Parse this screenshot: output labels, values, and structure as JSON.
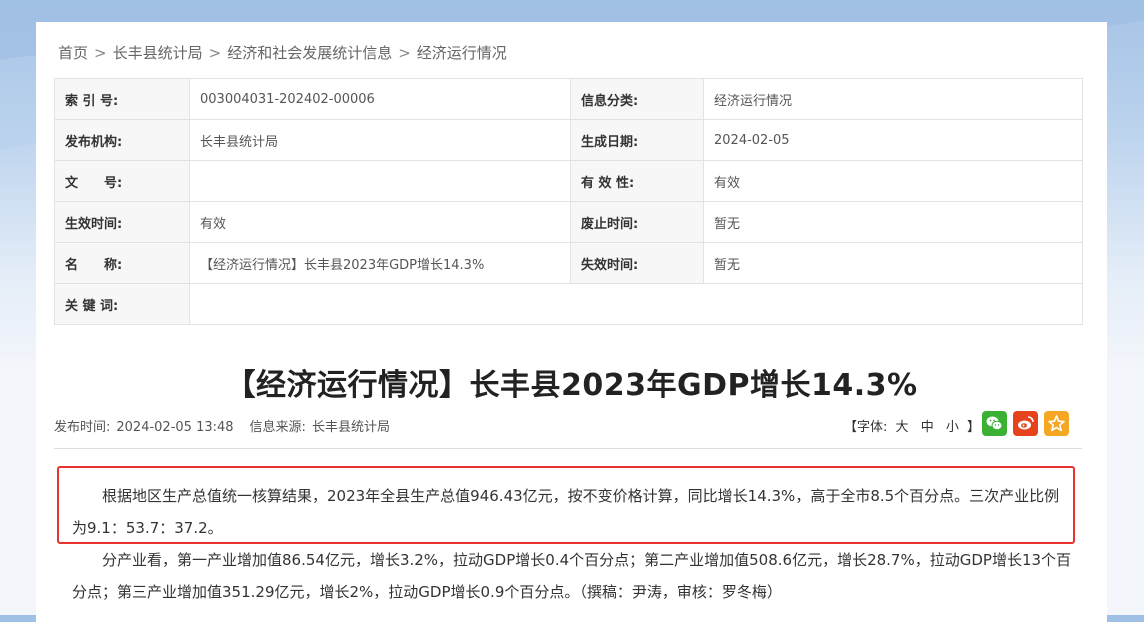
{
  "breadcrumb": [
    "首页",
    "长丰县统计局",
    "经济和社会发展统计信息",
    "经济运行情况"
  ],
  "breadcrumb_sep": ">",
  "meta": {
    "index_label": "索 引 号:",
    "index_value": "003004031-202402-00006",
    "category_label": "信息分类:",
    "category_value": "经济运行情况",
    "org_label": "发布机构:",
    "org_value": "长丰县统计局",
    "gen_date_label": "生成日期:",
    "gen_date_value": "2024-02-05",
    "doc_no_label": "文　　号:",
    "doc_no_value": "",
    "validity_label": "有 效 性:",
    "validity_value": "有效",
    "effective_label": "生效时间:",
    "effective_value": "有效",
    "repeal_label": "废止时间:",
    "repeal_value": "暂无",
    "name_label": "名　　称:",
    "name_value": "【经济运行情况】长丰县2023年GDP增长14.3%",
    "expire_label": "失效时间:",
    "expire_value": "暂无",
    "keywords_label": "关 键 词:",
    "keywords_value": ""
  },
  "article": {
    "title": "【经济运行情况】长丰县2023年GDP增长14.3%",
    "publish_label": "发布时间:",
    "publish_time": "2024-02-05 13:48",
    "source_label": "信息来源:",
    "source": "长丰县统计局",
    "font_open": "【字体:",
    "font_large": "大",
    "font_medium": "中",
    "font_small": "小",
    "font_close": "】",
    "para1": "根据地区生产总值统一核算结果，2023年全县生产总值946.43亿元，按不变价格计算，同比增长14.3%，高于全市8.5个百分点。三次产业比例为9.1：53.7：37.2。",
    "para2": "分产业看，第一产业增加值86.54亿元，增长3.2%，拉动GDP增长0.4个百分点；第二产业增加值508.6亿元，增长28.7%，拉动GDP增长13个百分点；第三产业增加值351.29亿元，增长2%，拉动GDP增长0.9个百分点。（撰稿：尹涛，审核：罗冬梅）"
  },
  "share_icons": [
    "wechat-icon",
    "weibo-icon",
    "favorite-star-icon"
  ],
  "colors": {
    "wechat": "#3bb134",
    "weibo": "#e6421c",
    "favorite": "#f5a623",
    "highlight": "#e8332f"
  }
}
